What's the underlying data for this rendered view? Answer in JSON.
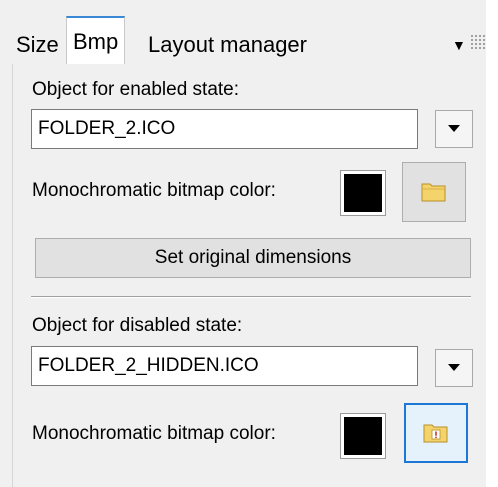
{
  "tabs": [
    {
      "label": "Size",
      "active": false
    },
    {
      "label": "Bmp",
      "active": true
    },
    {
      "label": "Layout manager",
      "active": false
    }
  ],
  "tab_menu_icon": "▼",
  "enabled": {
    "label": "Object for enabled state:",
    "value": "FOLDER_2.ICO",
    "mono_label": "Monochromatic bitmap color:",
    "mono_color": "#000000",
    "browse_icon": "folder-icon"
  },
  "set_original_label": "Set original dimensions",
  "disabled": {
    "label": "Object for disabled state:",
    "value": "FOLDER_2_HIDDEN.ICO",
    "mono_label": "Monochromatic bitmap color:",
    "mono_color": "#000000",
    "browse_icon": "folder-warning-icon"
  },
  "colors": {
    "accent": "#1c78d4",
    "tab_indicator": "#3a87d6",
    "folder": "#f5d36b"
  }
}
